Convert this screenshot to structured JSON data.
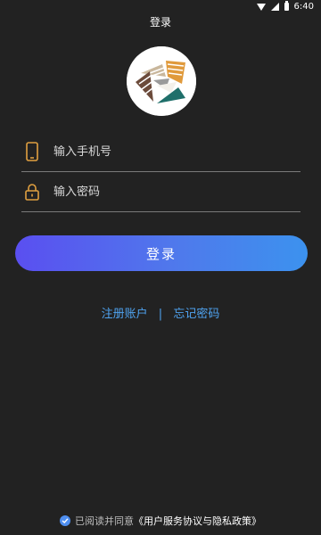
{
  "status_bar": {
    "time": "6:40"
  },
  "page": {
    "title": "登录"
  },
  "form": {
    "phone_placeholder": "输入手机号",
    "password_placeholder": "输入密码",
    "login_label": "登录"
  },
  "links": {
    "register": "注册账户",
    "separator": "|",
    "forgot": "忘记密码"
  },
  "agreement": {
    "checked": true,
    "prefix": "已阅读并同意",
    "link": "《用户服务协议与隐私政策》"
  },
  "colors": {
    "background": "#222222",
    "accent_start": "#5a4ff0",
    "accent_end": "#3c92ee",
    "link": "#4fa3f0",
    "icon": "#e0a040"
  },
  "icons": {
    "phone": "phone-icon",
    "lock": "lock-icon",
    "check": "check-icon"
  }
}
